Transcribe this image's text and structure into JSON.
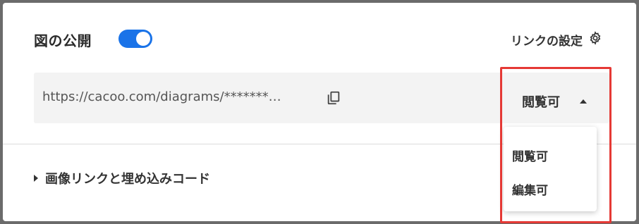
{
  "dialog": {
    "title": "図の公開",
    "public_toggle_on": true,
    "accent_color": "#1a73e8",
    "link_settings_label": "リンクの設定",
    "link_settings_icon": "gear-icon"
  },
  "share_link": {
    "url": "https://cacoo.com/diagrams/*******…",
    "copy_icon": "copy-icon",
    "permission_selected": "閲覧可"
  },
  "permission_dropdown": {
    "options": [
      "閲覧可",
      "編集可"
    ]
  },
  "embed_section": {
    "label": "画像リンクと埋め込みコード"
  },
  "annotation": {
    "highlight_color": "#e53935"
  }
}
